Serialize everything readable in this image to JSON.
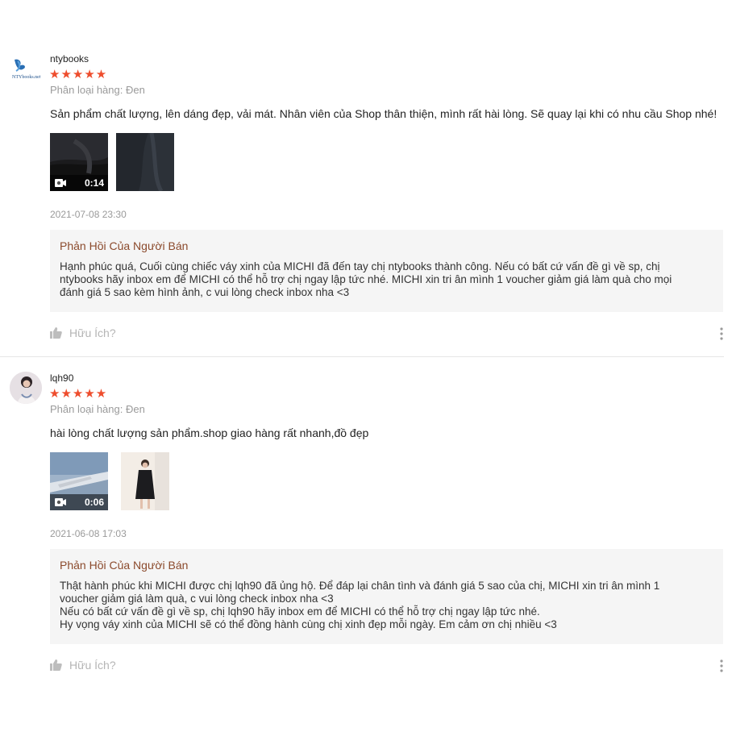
{
  "reviews": [
    {
      "username": "ntybooks",
      "avatar_text": "NTYbooks.net",
      "stars": "★★★★★",
      "variation": "Phân loại hàng: Đen",
      "content": "Sản phẩm chất lượng, lên dáng đẹp, vải mát. Nhân viên của Shop thân thiện, mình rất hài lòng. Sẽ quay lại khi có nhu cầu Shop nhé!",
      "video_duration": "0:14",
      "date": "2021-07-08 23:30",
      "reply_title": "Phản Hồi Của Người Bán",
      "reply_text": "Hạnh phúc quá, Cuối cùng chiếc váy xinh của MICHI đã đến tay chị ntybooks thành công. Nếu có bất cứ vấn đề gì về sp, chị\nntybooks hãy inbox em để MICHI có thể hỗ trợ chị ngay lập tức nhé. MICHI xin tri ân mình 1 voucher giảm giá làm quà cho mọi\nđánh giá 5 sao kèm hình ảnh, c vui lòng check inbox nha <3",
      "helpful": "Hữu Ích?"
    },
    {
      "username": "lqh90",
      "stars": "★★★★★",
      "variation": "Phân loại hàng: Đen",
      "content": "hài lòng chất lượng sản phẩm.shop giao hàng rất nhanh,đồ đẹp",
      "video_duration": "0:06",
      "date": "2021-06-08 17:03",
      "reply_title": "Phản Hồi Của Người Bán",
      "reply_text": "Thật hành phúc khi MICHI được chị lqh90 đã ủng hộ. Để đáp lại chân tình và đánh giá 5 sao của chị, MICHI xin tri ân mình 1\nvoucher giảm giá làm quà, c vui lòng check inbox nha <3\nNếu có bất cứ vấn đề gì về sp, chị lqh90 hãy inbox em để MICHI có thể hỗ trợ chị ngay lập tức nhé.\nHy vọng váy xinh của MICHI sẽ có thể đồng hành cùng chị xinh đẹp mỗi ngày.  Em cảm ơn chị nhiều <3",
      "helpful": "Hữu Ích?"
    }
  ],
  "colors": {
    "star": "#ee4d2d",
    "reply_title": "#8b4a2c",
    "reply_bg": "#f5f5f5"
  }
}
